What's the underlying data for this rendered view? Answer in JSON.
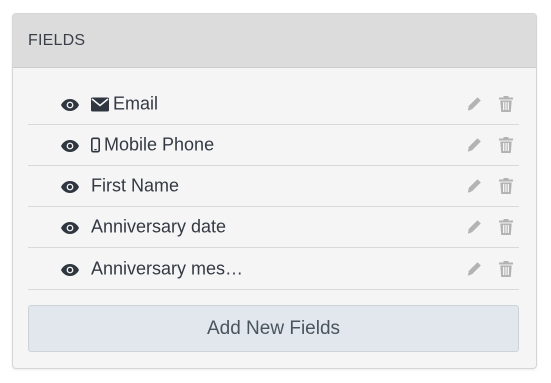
{
  "panel": {
    "title": "FIELDS"
  },
  "fields": [
    {
      "label": "Email",
      "type_icon": "envelope-icon"
    },
    {
      "label": "Mobile Phone",
      "type_icon": "mobile-phone-icon"
    },
    {
      "label": "First Name",
      "type_icon": ""
    },
    {
      "label": "Anniversary date",
      "type_icon": ""
    },
    {
      "label": "Anniversary mes…",
      "type_icon": ""
    }
  ],
  "actions": {
    "add_label": "Add New Fields"
  },
  "colors": {
    "header_bg": "#dcdcdc",
    "panel_bg": "#f5f5f5",
    "text": "#333a44",
    "action_icon": "#b0b0b0",
    "add_button_bg": "#e1e7ec"
  }
}
